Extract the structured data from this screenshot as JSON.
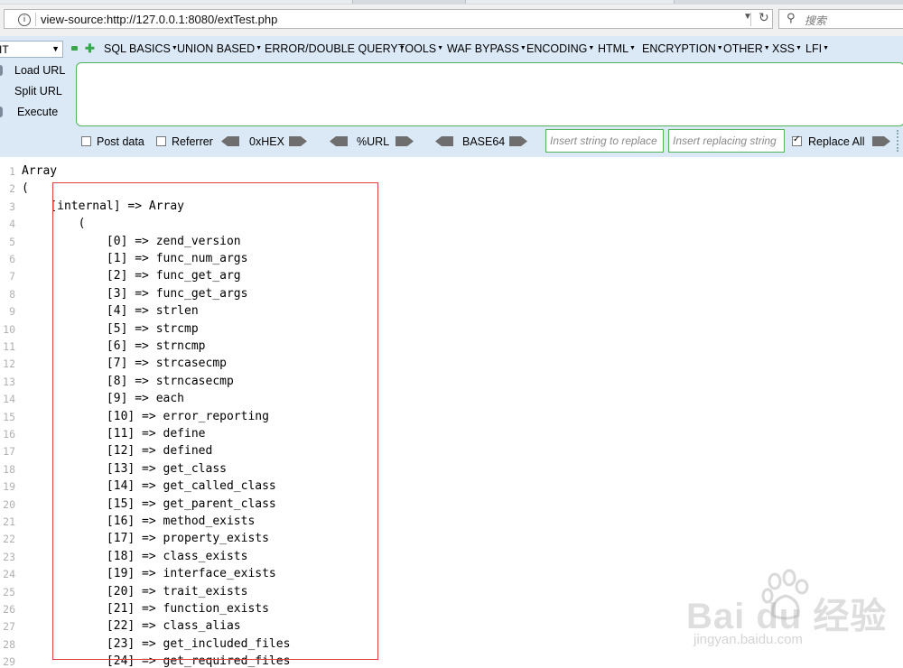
{
  "browser": {
    "url": "view-source:http://127.0.0.1:8080/extTest.php",
    "search_placeholder": "搜索"
  },
  "hackbar": {
    "select_value": "IT",
    "menus": [
      {
        "label": "SQL BASICS"
      },
      {
        "label": "UNION BASED"
      },
      {
        "label": "ERROR/DOUBLE QUERY"
      },
      {
        "label": "TOOLS"
      },
      {
        "label": "WAF BYPASS"
      },
      {
        "label": "ENCODING"
      },
      {
        "label": "HTML"
      },
      {
        "label": "ENCRYPTION"
      },
      {
        "label": "OTHER"
      },
      {
        "label": "XSS"
      },
      {
        "label": "LFI"
      }
    ],
    "side": {
      "load": "Load URL",
      "split": "Split URL",
      "execute": "Execute"
    },
    "post_data": {
      "label": "Post data",
      "checked": false
    },
    "referrer": {
      "label": "Referrer",
      "checked": false
    },
    "encoders": {
      "hex": "0xHEX",
      "url": "%URL",
      "base64": "BASE64"
    },
    "insert_string_placeholder": "Insert string to replace",
    "insert_replacing_placeholder": "Insert replacing string",
    "replace_all": {
      "label": "Replace All",
      "checked": true
    }
  },
  "source": {
    "lines": [
      {
        "n": "1",
        "text": "Array"
      },
      {
        "n": "2",
        "text": "("
      },
      {
        "n": "3",
        "text": "    [internal] => Array"
      },
      {
        "n": "4",
        "text": "        ("
      },
      {
        "n": "5",
        "text": "            [0] => zend_version"
      },
      {
        "n": "6",
        "text": "            [1] => func_num_args"
      },
      {
        "n": "7",
        "text": "            [2] => func_get_arg"
      },
      {
        "n": "8",
        "text": "            [3] => func_get_args"
      },
      {
        "n": "9",
        "text": "            [4] => strlen"
      },
      {
        "n": "10",
        "text": "            [5] => strcmp"
      },
      {
        "n": "11",
        "text": "            [6] => strncmp"
      },
      {
        "n": "12",
        "text": "            [7] => strcasecmp"
      },
      {
        "n": "13",
        "text": "            [8] => strncasecmp"
      },
      {
        "n": "14",
        "text": "            [9] => each"
      },
      {
        "n": "15",
        "text": "            [10] => error_reporting"
      },
      {
        "n": "16",
        "text": "            [11] => define"
      },
      {
        "n": "17",
        "text": "            [12] => defined"
      },
      {
        "n": "18",
        "text": "            [13] => get_class"
      },
      {
        "n": "19",
        "text": "            [14] => get_called_class"
      },
      {
        "n": "20",
        "text": "            [15] => get_parent_class"
      },
      {
        "n": "21",
        "text": "            [16] => method_exists"
      },
      {
        "n": "22",
        "text": "            [17] => property_exists"
      },
      {
        "n": "23",
        "text": "            [18] => class_exists"
      },
      {
        "n": "24",
        "text": "            [19] => interface_exists"
      },
      {
        "n": "25",
        "text": "            [20] => trait_exists"
      },
      {
        "n": "26",
        "text": "            [21] => function_exists"
      },
      {
        "n": "27",
        "text": "            [22] => class_alias"
      },
      {
        "n": "28",
        "text": "            [23] => get_included_files"
      },
      {
        "n": "29",
        "text": "            [24] => get_required_files"
      }
    ]
  },
  "watermark": {
    "logo": "Bai du 经验",
    "sub": "jingyan.baidu.com"
  },
  "colors": {
    "hackbar_bg": "#dbe9f7",
    "input_border": "#52b35a",
    "highlight": "#e04040"
  }
}
